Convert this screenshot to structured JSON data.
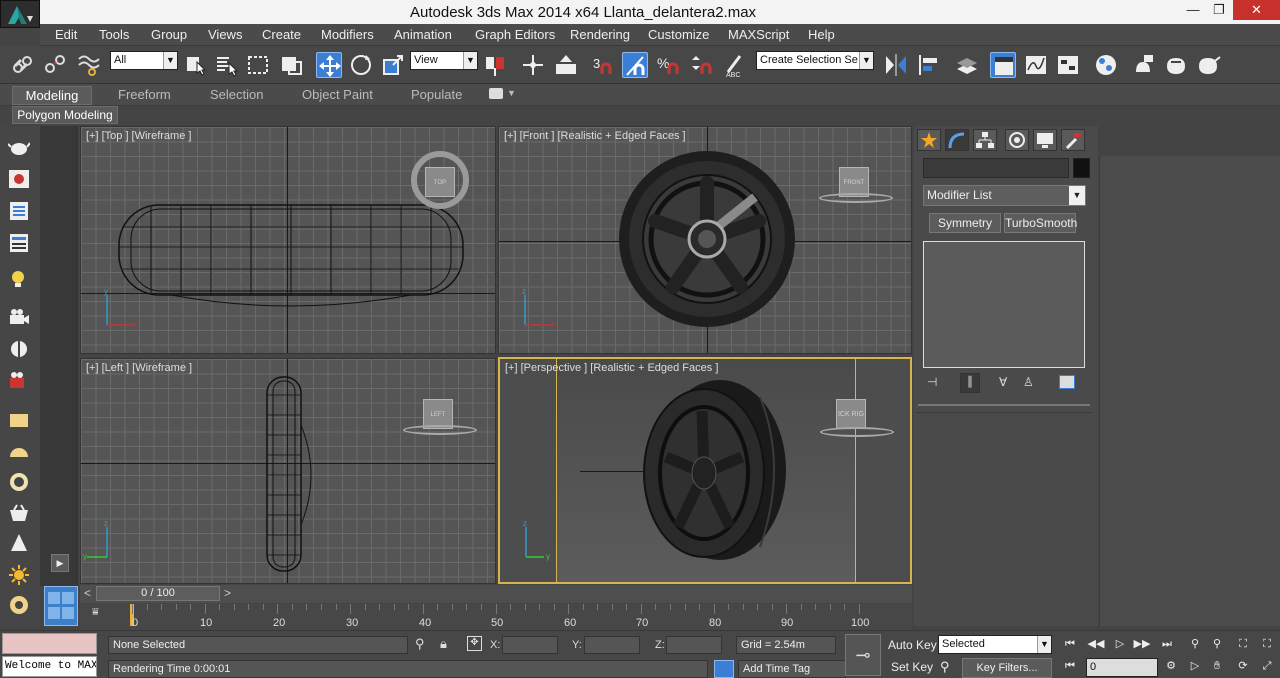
{
  "window": {
    "title": "Autodesk 3ds Max  2014 x64      Llanta_delantera2.max"
  },
  "menu": [
    "Edit",
    "Tools",
    "Group",
    "Views",
    "Create",
    "Modifiers",
    "Animation",
    "Graph Editors",
    "Rendering",
    "Customize",
    "MAXScript",
    "Help"
  ],
  "toolbar": {
    "selection_filter": "All",
    "reference_coord": "View",
    "named_selection": "Create Selection Se"
  },
  "ribbon": {
    "tabs": [
      "Modeling",
      "Freeform",
      "Selection",
      "Object Paint",
      "Populate"
    ],
    "panel": "Polygon Modeling"
  },
  "viewports": {
    "top": {
      "label": "[+] [Top ] [Wireframe ]",
      "cube": "TOP"
    },
    "front": {
      "label": "[+] [Front ] [Realistic + Edged Faces ]",
      "cube": "FRONT"
    },
    "left": {
      "label": "[+] [Left ] [Wireframe ]",
      "cube": "LEFT"
    },
    "perspective": {
      "label": "[+] [Perspective ] [Realistic + Edged Faces ]",
      "cube": "ICK  RIG"
    }
  },
  "command_panel": {
    "modifier_list": "Modifier List",
    "buttons": [
      "Symmetry",
      "TurboSmooth"
    ]
  },
  "timeline": {
    "frame": "0 / 100",
    "ticks": [
      "0",
      "10",
      "20",
      "30",
      "40",
      "50",
      "60",
      "70",
      "80",
      "90",
      "100"
    ]
  },
  "status": {
    "selection": "None Selected",
    "render_time": "Rendering Time  0:00:01",
    "x_label": "X:",
    "y_label": "Y:",
    "z_label": "Z:",
    "grid": "Grid = 2.54m",
    "add_time_tag": "Add Time Tag",
    "auto_key": "Auto Key",
    "set_key": "Set Key",
    "key_mode": "Selected",
    "key_filters": "Key Filters...",
    "current_frame": "0",
    "listener": "Welcome to MAXScript."
  }
}
